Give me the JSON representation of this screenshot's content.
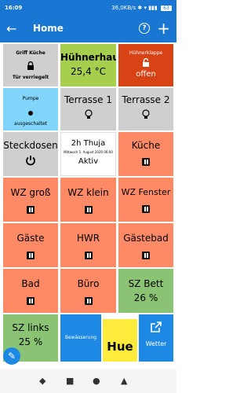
{
  "status": {
    "time": "16:09",
    "right_text": "36,0KB/s",
    "signal_glyphs": "✱ ▾ ▮▮▮",
    "battery": "63"
  },
  "appbar": {
    "back": "←",
    "title": "Home",
    "help": "?",
    "add": "+"
  },
  "tiles": [
    {
      "id": "griff-kueche",
      "title": "Griff Küche",
      "status": "Tür verriegelt"
    },
    {
      "id": "huehnerhaus",
      "title": "Hühnerhaus",
      "value": "25,4 °C"
    },
    {
      "id": "huehnerklappe",
      "title": "Hühnerklappe",
      "status": "offen"
    },
    {
      "id": "pumpe",
      "title": "Pumpe",
      "status": "ausgeschaltet"
    },
    {
      "id": "terrasse-1",
      "title": "Terrasse 1"
    },
    {
      "id": "terrasse-2",
      "title": "Terrasse 2"
    },
    {
      "id": "steckdosen",
      "title": "Steckdosen"
    },
    {
      "id": "thuja",
      "title": "2h Thuja",
      "subtitle": "Mittwoch 5. August 2020 06:00",
      "status": "Aktiv"
    },
    {
      "id": "kueche",
      "title": "Küche"
    },
    {
      "id": "wz-gross",
      "title": "WZ groß"
    },
    {
      "id": "wz-klein",
      "title": "WZ klein"
    },
    {
      "id": "wz-fenster",
      "title": "WZ Fenster"
    },
    {
      "id": "gaeste",
      "title": "Gäste"
    },
    {
      "id": "hwr",
      "title": "HWR"
    },
    {
      "id": "gaestebad",
      "title": "Gästebad"
    },
    {
      "id": "bad",
      "title": "Bad"
    },
    {
      "id": "buero",
      "title": "Büro"
    },
    {
      "id": "sz-bett",
      "title": "SZ Bett",
      "value": "26 %"
    },
    {
      "id": "sz-links",
      "title": "SZ links",
      "value": "25 %"
    },
    {
      "id": "bewaesserung",
      "title": "Bewässerung"
    },
    {
      "id": "hue",
      "title": "Hue"
    },
    {
      "id": "wetter",
      "title": "Wetter"
    }
  ],
  "fab": {
    "icon": "pencil-icon"
  },
  "bottomnav": {
    "glyphs": [
      "◆",
      "■",
      "●",
      "▲"
    ]
  }
}
